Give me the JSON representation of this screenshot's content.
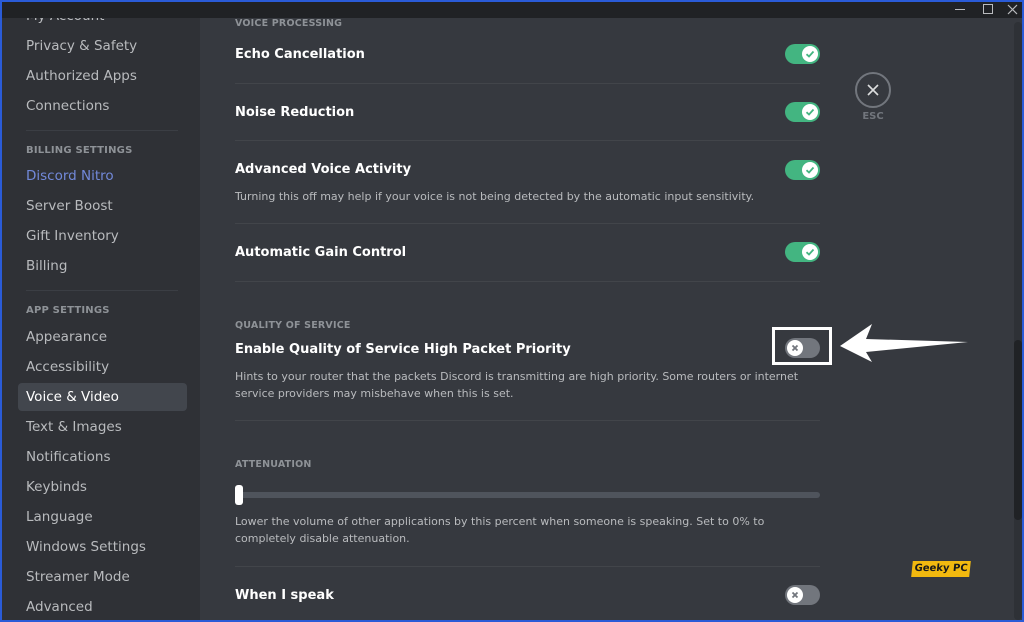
{
  "window": {
    "minimize_label": "–",
    "maximize_label": "□",
    "close_label": "✕"
  },
  "sidebar": {
    "items": [
      {
        "label": "My Account"
      },
      {
        "label": "Privacy & Safety"
      },
      {
        "label": "Authorized Apps"
      },
      {
        "label": "Connections"
      }
    ],
    "billing_header": "BILLING SETTINGS",
    "billing_items": [
      {
        "label": "Discord Nitro"
      },
      {
        "label": "Server Boost"
      },
      {
        "label": "Gift Inventory"
      },
      {
        "label": "Billing"
      }
    ],
    "app_header": "APP SETTINGS",
    "app_items": [
      {
        "label": "Appearance"
      },
      {
        "label": "Accessibility"
      },
      {
        "label": "Voice & Video",
        "active": true
      },
      {
        "label": "Text & Images"
      },
      {
        "label": "Notifications"
      },
      {
        "label": "Keybinds"
      },
      {
        "label": "Language"
      },
      {
        "label": "Windows Settings"
      },
      {
        "label": "Streamer Mode"
      },
      {
        "label": "Advanced"
      }
    ]
  },
  "main": {
    "voice_processing": {
      "header": "VOICE PROCESSING",
      "settings": [
        {
          "title": "Echo Cancellation",
          "enabled": true
        },
        {
          "title": "Noise Reduction",
          "enabled": true
        },
        {
          "title": "Advanced Voice Activity",
          "description": "Turning this off may help if your voice is not being detected by the automatic input sensitivity.",
          "enabled": true
        },
        {
          "title": "Automatic Gain Control",
          "enabled": true
        }
      ]
    },
    "quality_of_service": {
      "header": "QUALITY OF SERVICE",
      "title": "Enable Quality of Service High Packet Priority",
      "description": "Hints to your router that the packets Discord is transmitting are high priority. Some routers or internet service providers may misbehave when this is set.",
      "enabled": false
    },
    "attenuation": {
      "header": "ATTENUATION",
      "value_percent": 0,
      "description": "Lower the volume of other applications by this percent when someone is speaking. Set to 0% to completely disable attenuation."
    },
    "when_i_speak": {
      "title": "When I speak",
      "enabled": false
    }
  },
  "esc": {
    "label": "ESC",
    "icon": "close-icon"
  },
  "watermark": "Geeky PC",
  "colors": {
    "toggle_on": "#43b581",
    "toggle_off": "#72767d",
    "accent": "#7289da",
    "sidebar_bg": "#2f3136",
    "content_bg": "#36393f"
  }
}
